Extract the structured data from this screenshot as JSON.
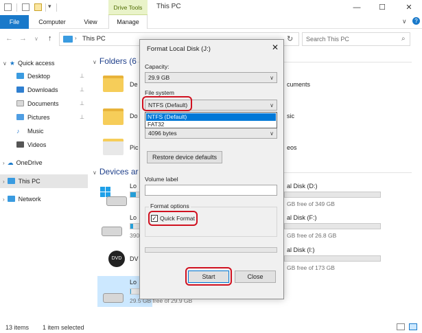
{
  "window": {
    "title": "This PC",
    "context_tab": "Drive Tools",
    "minimize": "—",
    "maximize": "☐",
    "close": "✕"
  },
  "ribbon": {
    "tabs": [
      "File",
      "Computer",
      "View",
      "Manage"
    ],
    "chevron": "∨",
    "help": "?"
  },
  "nav": {
    "back": "←",
    "forward": "→",
    "recent": "∨",
    "up": "↑",
    "path": "This PC",
    "refresh": "↻",
    "search_placeholder": "Search This PC"
  },
  "sidebar": {
    "items": [
      {
        "label": "Quick access",
        "pinned": false
      },
      {
        "label": "Desktop",
        "pinned": true
      },
      {
        "label": "Downloads",
        "pinned": true
      },
      {
        "label": "Documents",
        "pinned": true
      },
      {
        "label": "Pictures",
        "pinned": true
      },
      {
        "label": "Music",
        "pinned": false
      },
      {
        "label": "Videos",
        "pinned": false
      },
      {
        "label": "OneDrive",
        "pinned": false
      },
      {
        "label": "This PC",
        "pinned": false
      },
      {
        "label": "Network",
        "pinned": false
      }
    ],
    "pin_glyph": "📌"
  },
  "main": {
    "folders_heading": "Folders (6",
    "devices_heading": "Devices ar",
    "folders": [
      {
        "label": "De"
      },
      {
        "label": "cuments"
      },
      {
        "label": "Do"
      },
      {
        "label": "sic"
      },
      {
        "label": "Pic"
      },
      {
        "label": "eos"
      }
    ],
    "drives": [
      {
        "name": "Lo",
        "free": "",
        "fill": 0.6
      },
      {
        "name": "al Disk (D:)",
        "free": "GB free of 349 GB",
        "fill": 0.0
      },
      {
        "name": "Lo",
        "free": "390",
        "fill": 0.3
      },
      {
        "name": "al Disk (F:)",
        "free": "GB free of 26.8 GB",
        "fill": 0.0
      },
      {
        "name": "DV",
        "free": "",
        "fill": 0.0
      },
      {
        "name": "al Disk (I:)",
        "free": "GB free of 173 GB",
        "fill": 0.0
      },
      {
        "name": "Lo",
        "free": "29.5 GB free of 29.9 GB",
        "fill": 0.02
      }
    ]
  },
  "status": {
    "items": "13 items",
    "selected": "1 item selected"
  },
  "dialog": {
    "title": "Format Local Disk (J:)",
    "close": "✕",
    "capacity_label": "Capacity:",
    "capacity_value": "29.9 GB",
    "filesystem_label": "File system",
    "filesystem_value": "NTFS (Default)",
    "filesystem_options": [
      "NTFS (Default)",
      "FAT32"
    ],
    "allocation_value": "4096 bytes",
    "restore_button": "Restore device defaults",
    "volume_label": "Volume label",
    "volume_value": "",
    "format_options_label": "Format options",
    "quick_format_label": "Quick Format",
    "quick_format_checked": true,
    "check_glyph": "✓",
    "start_button": "Start",
    "close_button": "Close"
  },
  "colors": {
    "accent": "#1979ca",
    "highlight_ring": "#d0101f",
    "selection": "#0078d7"
  }
}
